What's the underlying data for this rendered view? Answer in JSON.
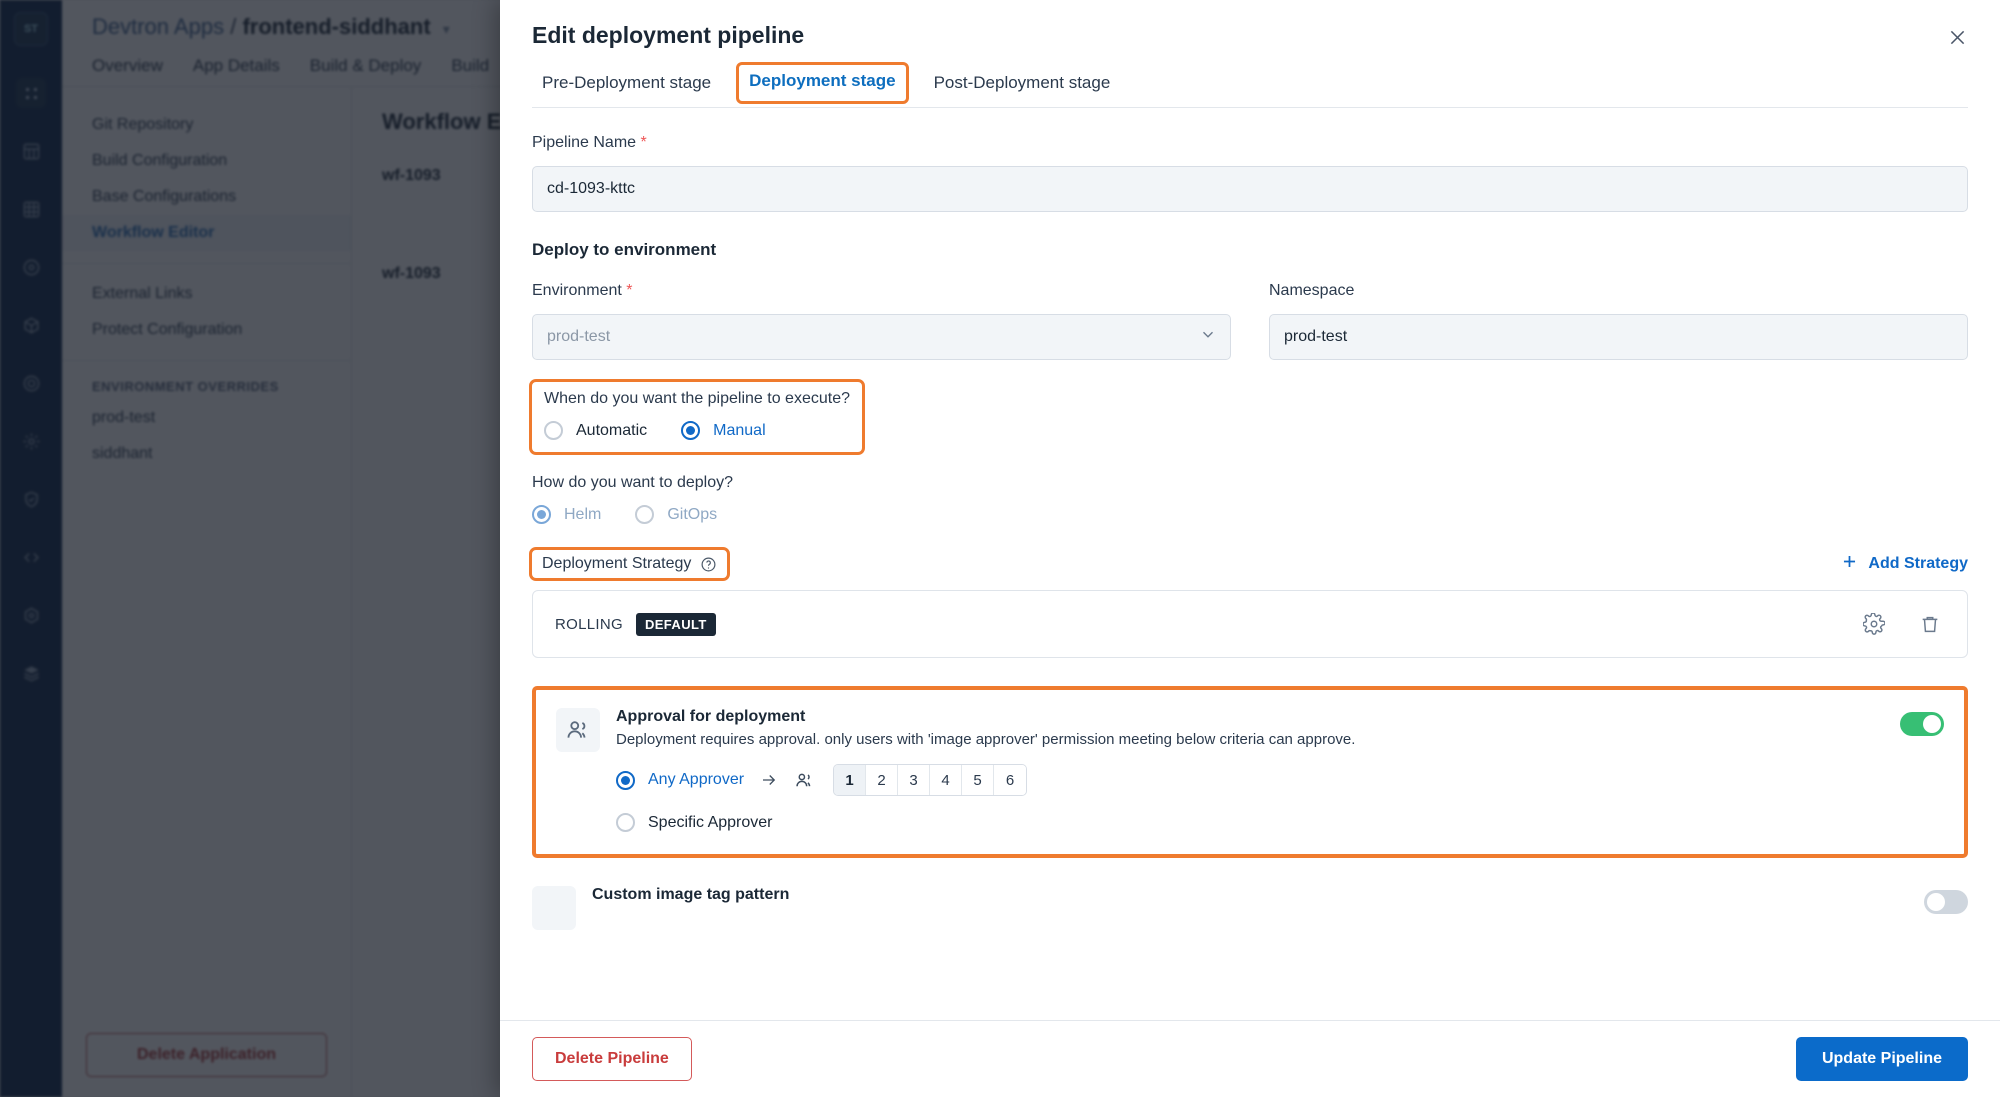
{
  "background": {
    "rail": {
      "logo_text": "ST",
      "icons": [
        "apps-grid-icon",
        "chart-grid-icon",
        "clusters-grid-icon",
        "stack-manager-icon",
        "cube-icon",
        "security-scan-icon",
        "gear-icon",
        "shield-check-icon",
        "code-icon",
        "settings-hex-icon",
        "layers-icon"
      ]
    },
    "breadcrumb": {
      "first": "Devtron Apps",
      "separator": "/",
      "app": "frontend-siddhant"
    },
    "tabs": [
      "Overview",
      "App Details",
      "Build & Deploy",
      "Build"
    ],
    "sidebar": {
      "items": [
        "Git Repository",
        "Build Configuration",
        "Base Configurations",
        "Workflow Editor"
      ],
      "selected": "Workflow Editor",
      "secondary": [
        "External Links",
        "Protect Configuration"
      ],
      "overrides_heading": "ENVIRONMENT OVERRIDES",
      "overrides": [
        "prod-test",
        "siddhant"
      ],
      "delete_app_label": "Delete Application"
    },
    "content": {
      "title": "Workflow Editor",
      "rows": [
        "wf-1093",
        "wf-1093"
      ]
    }
  },
  "modal": {
    "title": "Edit deployment pipeline",
    "close_icon": "close-icon",
    "tabs": [
      {
        "label": "Pre-Deployment stage",
        "active": false,
        "highlighted": false
      },
      {
        "label": "Deployment stage",
        "active": true,
        "highlighted": true
      },
      {
        "label": "Post-Deployment stage",
        "active": false,
        "highlighted": false
      }
    ],
    "pipeline_name": {
      "label": "Pipeline Name",
      "required_marker": "*",
      "value": "cd-1093-kttc"
    },
    "deploy_to_environment": {
      "section_title": "Deploy to environment",
      "environment": {
        "label": "Environment",
        "required_marker": "*",
        "value": "prod-test",
        "disabled": true,
        "caret_icon": "chevron-down-icon"
      },
      "namespace": {
        "label": "Namespace",
        "value": "prod-test"
      }
    },
    "execute_trigger": {
      "question": "When do you want the pipeline to execute?",
      "options": [
        {
          "label": "Automatic",
          "selected": false
        },
        {
          "label": "Manual",
          "selected": true
        }
      ],
      "highlighted": true
    },
    "deploy_method": {
      "question": "How do you want to deploy?",
      "options": [
        {
          "label": "Helm",
          "selected": true,
          "disabled": true
        },
        {
          "label": "GitOps",
          "selected": false,
          "disabled": true
        }
      ]
    },
    "deployment_strategy": {
      "label": "Deployment Strategy",
      "help_icon": "help-circle-icon",
      "highlighted": true,
      "add_strategy_label": "Add Strategy",
      "add_icon": "plus-icon",
      "strategies": [
        {
          "name": "ROLLING",
          "badge": "DEFAULT",
          "settings_icon": "gear-icon",
          "delete_icon": "trash-icon"
        }
      ]
    },
    "approval": {
      "icon": "users-approval-icon",
      "title": "Approval for deployment",
      "description": "Deployment requires approval. only users with 'image approver' permission meeting below criteria can approve.",
      "toggle_on": true,
      "toggle_color": "#37bf74",
      "highlighted": true,
      "options": [
        {
          "label": "Any Approver",
          "selected": true
        },
        {
          "label": "Specific Approver",
          "selected": false
        }
      ],
      "arrow_icon": "arrow-right-icon",
      "approvers_icon": "users-icon",
      "counts": [
        "1",
        "2",
        "3",
        "4",
        "5",
        "6"
      ],
      "selected_count": "1"
    },
    "custom_image_tag": {
      "title": "Custom image tag pattern",
      "toggle_on": false
    },
    "footer": {
      "delete_label": "Delete Pipeline",
      "update_label": "Update Pipeline"
    }
  }
}
